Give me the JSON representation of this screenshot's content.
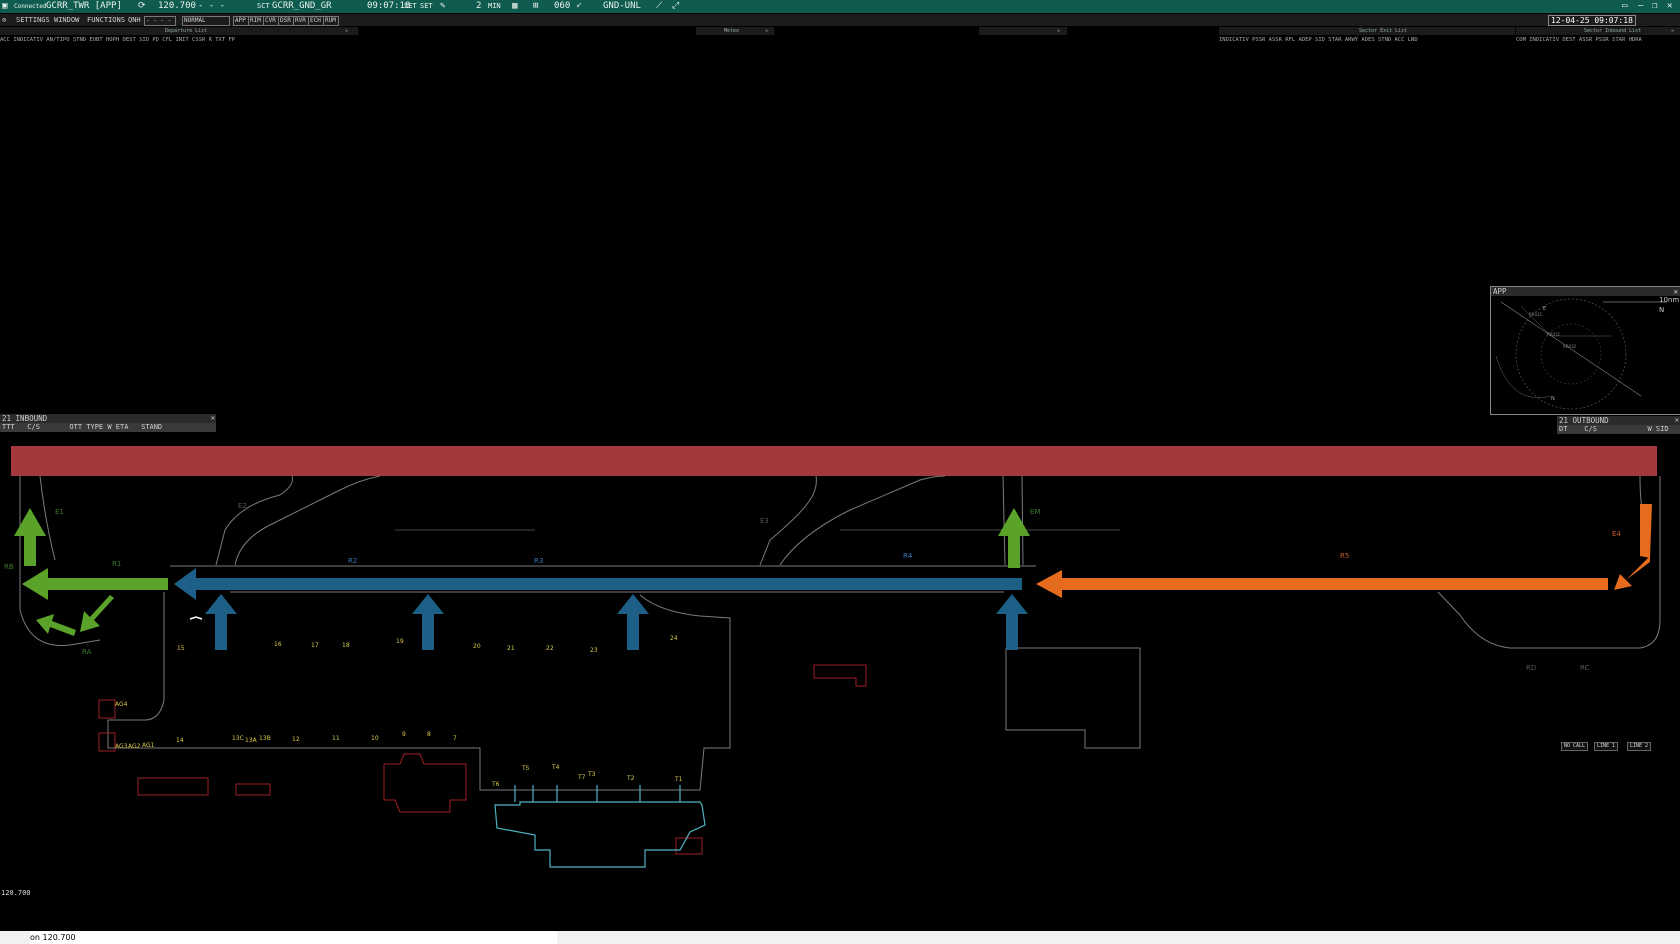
{
  "topbar": {
    "login_status": "Connected",
    "position": "GCRR_TWR [APP]",
    "frequency": "120.700",
    "freq_dashes": "-   -   -",
    "sector_prefix": "SCT",
    "sector": "GCRR_GND_GR",
    "time": "09:07:18",
    "set_a": "SET",
    "set_b": "SET",
    "min_count": "2",
    "min_label": "MIN",
    "rwy_hdg": "060",
    "level": "GND-UNL",
    "date_time": "12-04-25 09:07:18"
  },
  "menu": {
    "settings": "SETTINGS",
    "window": "WINDOW",
    "functions": "FUNCTIONS",
    "qnh": "QNH",
    "qnh_value": "- - - -",
    "mode": "NORMAL",
    "buttons": [
      "APP",
      "RIM",
      "CVR",
      "DSR",
      "RVR",
      "ECH",
      "RUM"
    ]
  },
  "departure_list": {
    "title": "Departure List",
    "columns": "ACC  INDICATIV AN/TIPO STND  EOBT  HOPH  DEST     SID       PD    CFL   INIT  CSSR  R         TXT        FP"
  },
  "meteo": {
    "title": "Meteo"
  },
  "sector_exit_list": {
    "title": "Sector Exit List",
    "columns": "INDICATIV PSSR  ASSR  RFL   ADEP    SID      STAR   ARWY ADES  STND   ACC  LND"
  },
  "sector_inbound_list": {
    "title": "Sector Inbound List",
    "columns": "COM  INDICATIV DEST  ASSR  PSSR   STAR  HDRA"
  },
  "inbound_panel": {
    "title": "21 INBOUND",
    "columns": "TTT   C/S       OTT TYPE W ETA   STAND"
  },
  "outbound_panel": {
    "title": "21 OUTBOUND",
    "columns": "DT    C/S            W SID"
  },
  "app_window": {
    "title": "APP",
    "scale": "10nm",
    "north": "N",
    "fixes": [
      "E",
      "RR021",
      "RR031",
      "RR032",
      "N"
    ]
  },
  "taxiways": {
    "e1": "E1",
    "e2": "E2",
    "e3": "E3",
    "e_mid": "EM",
    "e4": "E4",
    "r1": "R1",
    "r2": "R2",
    "r3": "R3",
    "r4": "R4",
    "r5": "R5",
    "ra": "RA",
    "rb": "RB",
    "rc": "RC",
    "rd": "RD",
    "r_left": "RB"
  },
  "stands": [
    "15",
    "16",
    "17",
    "18",
    "19",
    "20",
    "21",
    "22",
    "23",
    "24",
    "AG4",
    "AG3",
    "AG2",
    "AG1",
    "14",
    "13C",
    "13A",
    "13B",
    "12",
    "11",
    "10",
    "9",
    "8",
    "7",
    "T6",
    "T5",
    "T4",
    "T7",
    "T3",
    "T2",
    "T1"
  ],
  "status_buttons": [
    "NO CALL",
    "LINE 1",
    "LINE 2"
  ],
  "frequency_label": "120.700",
  "command_line": {
    "value": "on 120.700"
  },
  "colors": {
    "topbar": "#0f5b4f",
    "runway": "#a3393d",
    "green_arrow": "#5aa22a",
    "blue_arrow": "#1d5f87",
    "orange_arrow": "#e46c1c",
    "taxiway_outline": "#7a7a7a",
    "terminal": "#4fb3c2",
    "building": "#9e1f24",
    "stand_label": "#d9c94a",
    "taxiway_label_blue": "#3a78b8",
    "taxiway_label_green": "#3c7a2c",
    "taxiway_label_orange": "#c45a2a"
  }
}
